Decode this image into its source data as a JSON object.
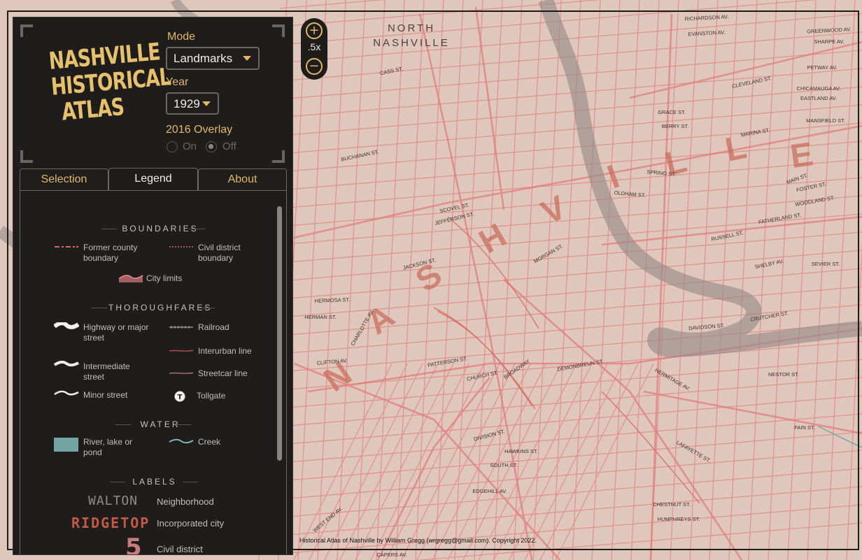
{
  "app": {
    "title_lines": [
      "NASHVILLE",
      "HISTORICAL",
      "ATLAS"
    ]
  },
  "controls": {
    "mode_label": "Mode",
    "mode_value": "Landmarks",
    "year_label": "Year",
    "year_value": "1929",
    "overlay_label": "2016 Overlay",
    "overlay_on": "On",
    "overlay_off": "Off",
    "overlay_selected": "Off"
  },
  "tabs": [
    {
      "label": "Selection",
      "active": false
    },
    {
      "label": "Legend",
      "active": true
    },
    {
      "label": "About",
      "active": false
    }
  ],
  "legend": {
    "boundaries": {
      "title": "BOUNDARIES",
      "items": [
        "Former county boundary",
        "Civil district boundary",
        "City limits"
      ]
    },
    "thoroughfares": {
      "title": "THOROUGHFARES",
      "items": [
        "Highway or major street",
        "Railroad",
        "Interurban line",
        "Intermediate street",
        "Streetcar line",
        "Minor street",
        "Tollgate"
      ]
    },
    "water": {
      "title": "WATER",
      "items": [
        "River, lake or pond",
        "Creek"
      ]
    },
    "labels": {
      "title": "LABELS",
      "items": [
        {
          "sample": "WALTON",
          "desc": "Neighborhood"
        },
        {
          "sample": "RIDGETOP",
          "desc": "Incorporated city"
        },
        {
          "sample": "5",
          "desc": "Civil district"
        }
      ]
    }
  },
  "zoom": {
    "in_icon": "+",
    "out_icon": "−",
    "level": ".5x"
  },
  "map": {
    "city_letters": [
      "N",
      "A",
      "S",
      "H",
      "V",
      "I",
      "L",
      "L",
      "E"
    ],
    "north_nashville": [
      "NORTH",
      "NASHVILLE"
    ],
    "streets": [
      "CASS ST.",
      "BUCHANAN ST.",
      "JEFFERSON ST.",
      "JACKSON ST.",
      "CHURCH ST.",
      "BROADWAY",
      "DIVISION ST.",
      "WEST END AV.",
      "CHARLOTTE AV.",
      "MAIN ST.",
      "WOODLAND ST.",
      "RUSSELL ST.",
      "SHELBY AV.",
      "DAVIDSON ST.",
      "HERMITAGE AV.",
      "LAFAYETTE ST.",
      "FATHERLAND ST.",
      "CLEVELAND ST.",
      "EVANSTON AV.",
      "RICHARDSON AV.",
      "GREENWOOD AV.",
      "SEVIER ST.",
      "NESTOR ST.",
      "HERMOSA ST.",
      "CLIFTON AV.",
      "HAWKINS ST.",
      "SOUTH ST.",
      "EDGEHILL AV.",
      "CHESTNUT ST.",
      "HUMPHREYS ST.",
      "SPRING ST.",
      "OLDHAM ST.",
      "DEMONBREUN ST.",
      "PATTERSON ST.",
      "HERMAN ST.",
      "CRUTCHER ST.",
      "MARINA ST.",
      "FAIN ST.",
      "CAPERS AV.",
      "MORGAN ST.",
      "SCOVEL ST.",
      "FOSTER ST.",
      "GRACE ST.",
      "BERRY ST.",
      "EASTLAND AV.",
      "PETWAY AV.",
      "SHARPE AV.",
      "CHICAMAUGA AV.",
      "MANSFIELD ST."
    ]
  },
  "credit": "Historical Atlas of Nashville by William Gregg (wrgregg@gmail.com). Copyright 2022.",
  "colors": {
    "panel_bg": "#1f1c1c",
    "accent": "#e2b866",
    "map_bg": "#dfc8bb",
    "street": "#e08a8a",
    "river": "#9a8a8a",
    "label_red": "#c45a48"
  }
}
